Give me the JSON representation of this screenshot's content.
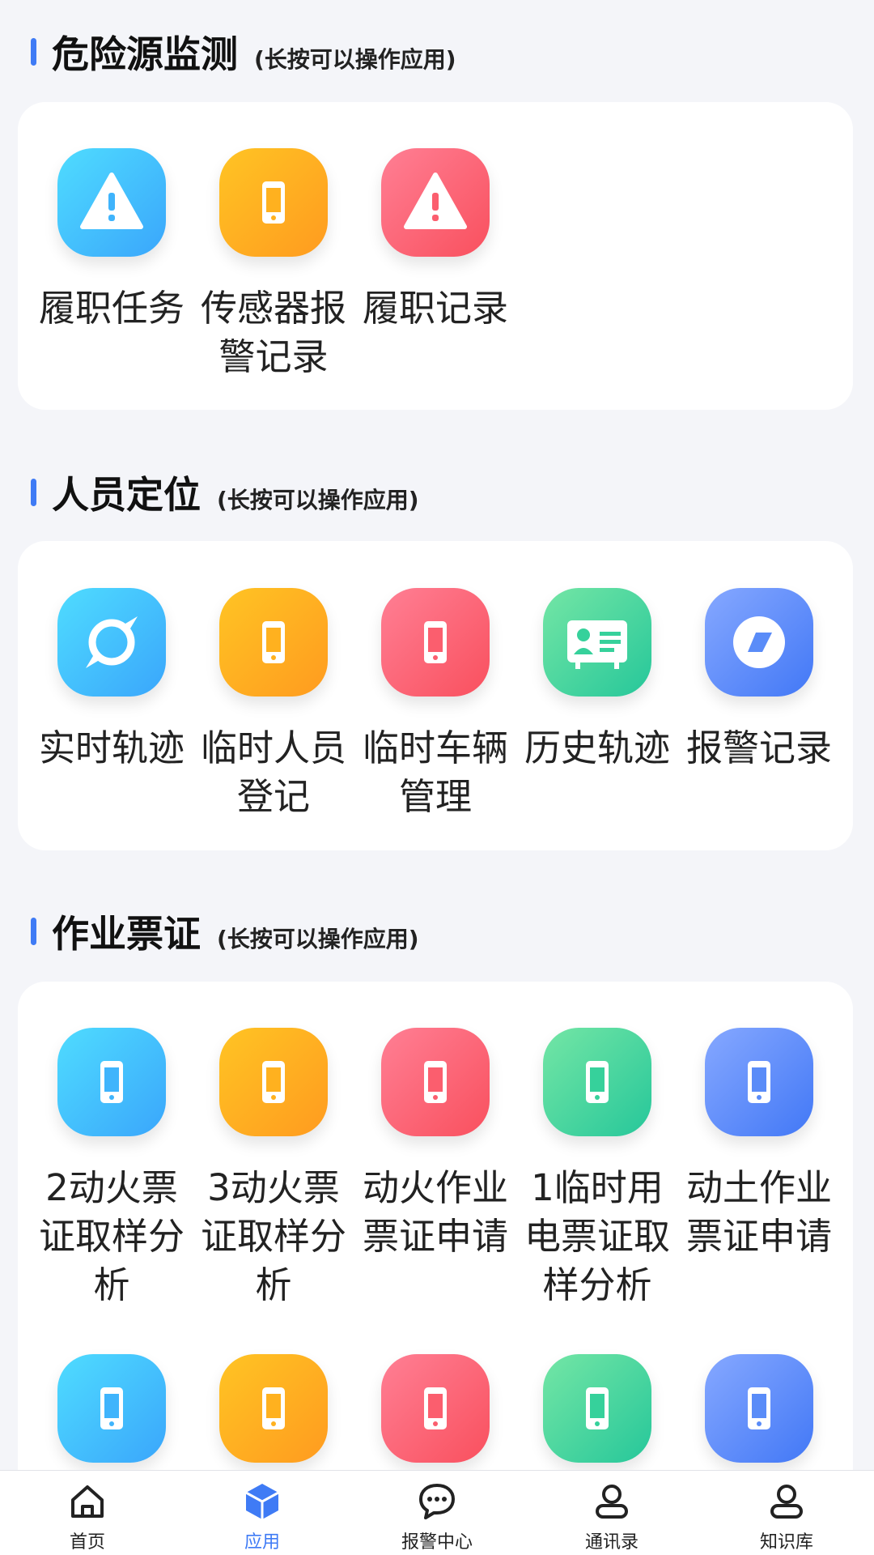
{
  "hint": "(长按可以操作应用)",
  "sections": [
    {
      "title": "危险源监测",
      "items": [
        {
          "label": "履职任务",
          "icon": "warning-icon",
          "color": "blue"
        },
        {
          "label": "传感器报警记录",
          "icon": "phone-icon",
          "color": "orange"
        },
        {
          "label": "履职记录",
          "icon": "warning-icon",
          "color": "red"
        }
      ]
    },
    {
      "title": "人员定位",
      "items": [
        {
          "label": "实时轨迹",
          "icon": "orbit-icon",
          "color": "blue"
        },
        {
          "label": "临时人员登记",
          "icon": "phone-icon",
          "color": "orange"
        },
        {
          "label": "临时车辆管理",
          "icon": "phone-icon",
          "color": "red"
        },
        {
          "label": "历史轨迹",
          "icon": "id-card-icon",
          "color": "green"
        },
        {
          "label": "报警记录",
          "icon": "compass-icon",
          "color": "indigo"
        }
      ]
    },
    {
      "title": "作业票证",
      "items": [
        {
          "label": "2动火票证取样分析",
          "icon": "phone-icon",
          "color": "blue"
        },
        {
          "label": "3动火票证取样分析",
          "icon": "phone-icon",
          "color": "orange"
        },
        {
          "label": "动火作业票证申请",
          "icon": "phone-icon",
          "color": "red"
        },
        {
          "label": "1临时用电票证取样分析",
          "icon": "phone-icon",
          "color": "green"
        },
        {
          "label": "动土作业票证申请",
          "icon": "phone-icon",
          "color": "indigo"
        },
        {
          "label": "",
          "icon": "phone-icon",
          "color": "blue"
        },
        {
          "label": "",
          "icon": "phone-icon",
          "color": "orange"
        },
        {
          "label": "",
          "icon": "phone-icon",
          "color": "red"
        },
        {
          "label": "",
          "icon": "phone-icon",
          "color": "green"
        },
        {
          "label": "",
          "icon": "phone-icon",
          "color": "indigo"
        }
      ]
    }
  ],
  "tabs": [
    {
      "label": "首页",
      "icon": "home-icon",
      "active": false
    },
    {
      "label": "应用",
      "icon": "cube-icon",
      "active": true
    },
    {
      "label": "报警中心",
      "icon": "chat-icon",
      "active": false
    },
    {
      "label": "通讯录",
      "icon": "user-icon",
      "active": false
    },
    {
      "label": "知识库",
      "icon": "user-icon",
      "active": false
    }
  ],
  "colors": {
    "accent": "#3f7bf5",
    "background": "#f4f5f9"
  }
}
